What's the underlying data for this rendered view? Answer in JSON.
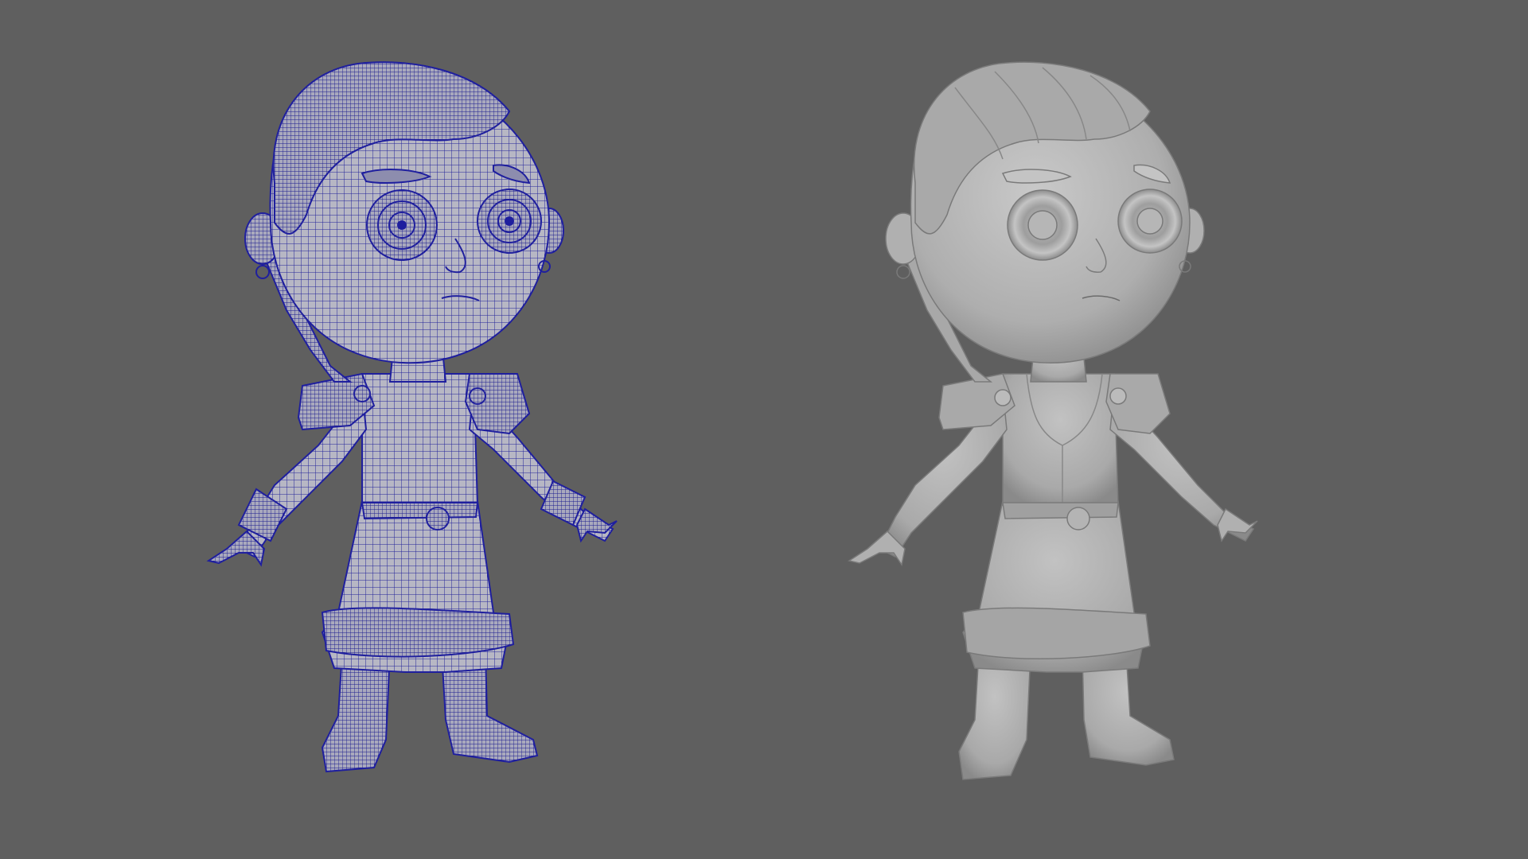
{
  "viewport": {
    "background_color": "#5f5f5f",
    "display_modes": [
      "wireframe-on-shaded",
      "smooth-shaded"
    ]
  },
  "models": {
    "left": {
      "mode": "wireframe-on-shaded",
      "wire_color": "#1f1f9e",
      "surface_color": "#b9b9c4"
    },
    "right": {
      "mode": "smooth-shaded",
      "surface_color": "#b3b3b3"
    }
  }
}
